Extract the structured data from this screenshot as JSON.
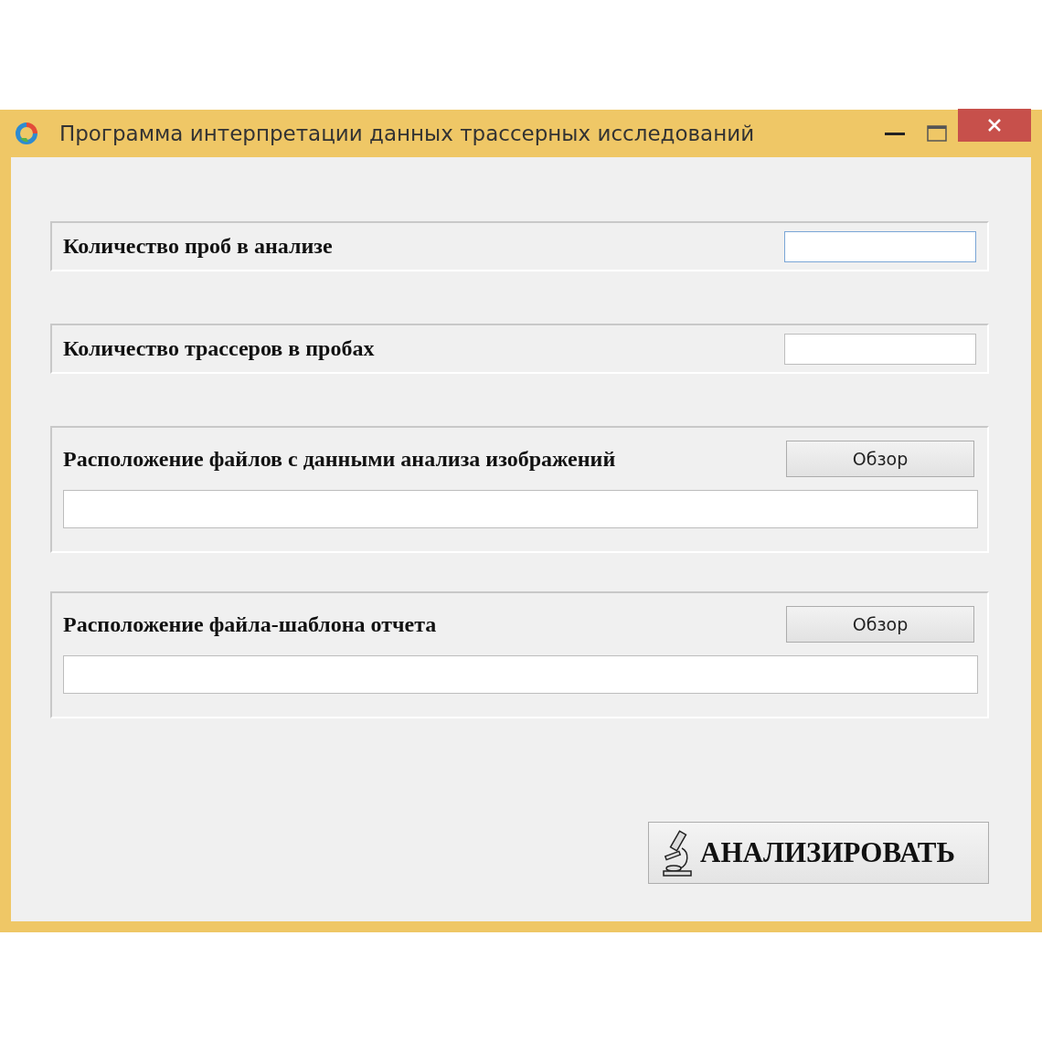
{
  "window": {
    "title": "Программа интерпретации данных трассерных исследований"
  },
  "sections": [
    {
      "kind": "number",
      "label": "Количество проб в анализе",
      "focused": true
    },
    {
      "kind": "number",
      "label": "Количество трассеров в пробах",
      "focused": false
    },
    {
      "kind": "path",
      "label": "Расположение файлов с данными анализа изображений",
      "browse": "Обзор",
      "focused": false
    },
    {
      "kind": "path",
      "label": "Расположение файла-шаблона отчета",
      "browse": "Обзор",
      "focused": false
    }
  ],
  "analyze_button": {
    "label": "АНАЛИЗИРОВАТЬ"
  }
}
